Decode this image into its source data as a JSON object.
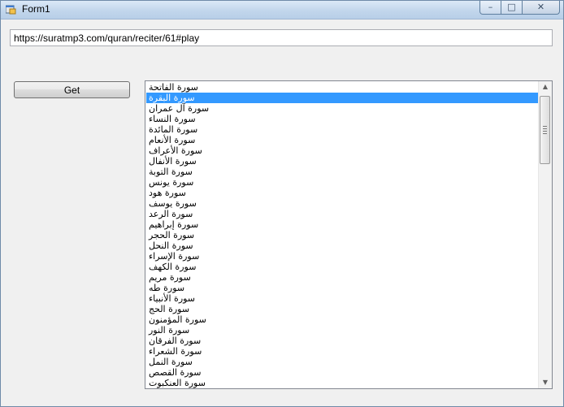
{
  "window": {
    "title": "Form1",
    "icon": "winforms-app-icon"
  },
  "controls": {
    "minimize": "–",
    "maximize": "□",
    "close": "✕"
  },
  "url": {
    "value": "https://suratmp3.com/quran/reciter/61#play"
  },
  "get_button": {
    "label": "Get"
  },
  "list": {
    "selected_index": 1,
    "items": [
      "سورة الفاتحة",
      "سورة البقرة",
      "سورة آل عمران",
      "سورة النساء",
      "سورة المائدة",
      "سورة الأنعام",
      "سورة الأعراف",
      "سورة الأنفال",
      "سورة التوبة",
      "سورة يونس",
      "سورة هود",
      "سورة يوسف",
      "سورة الرعد",
      "سورة إبراهيم",
      "سورة الحجر",
      "سورة النحل",
      "سورة الإسراء",
      "سورة الكهف",
      "سورة مريم",
      "سورة طه",
      "سورة الأنبياء",
      "سورة الحج",
      "سورة المؤمنون",
      "سورة النور",
      "سورة الفرقان",
      "سورة الشعراء",
      "سورة النمل",
      "سورة القصص",
      "سورة العنكبوت"
    ]
  },
  "colors": {
    "selection": "#3399ff",
    "window_bg": "#f0f0f0"
  }
}
